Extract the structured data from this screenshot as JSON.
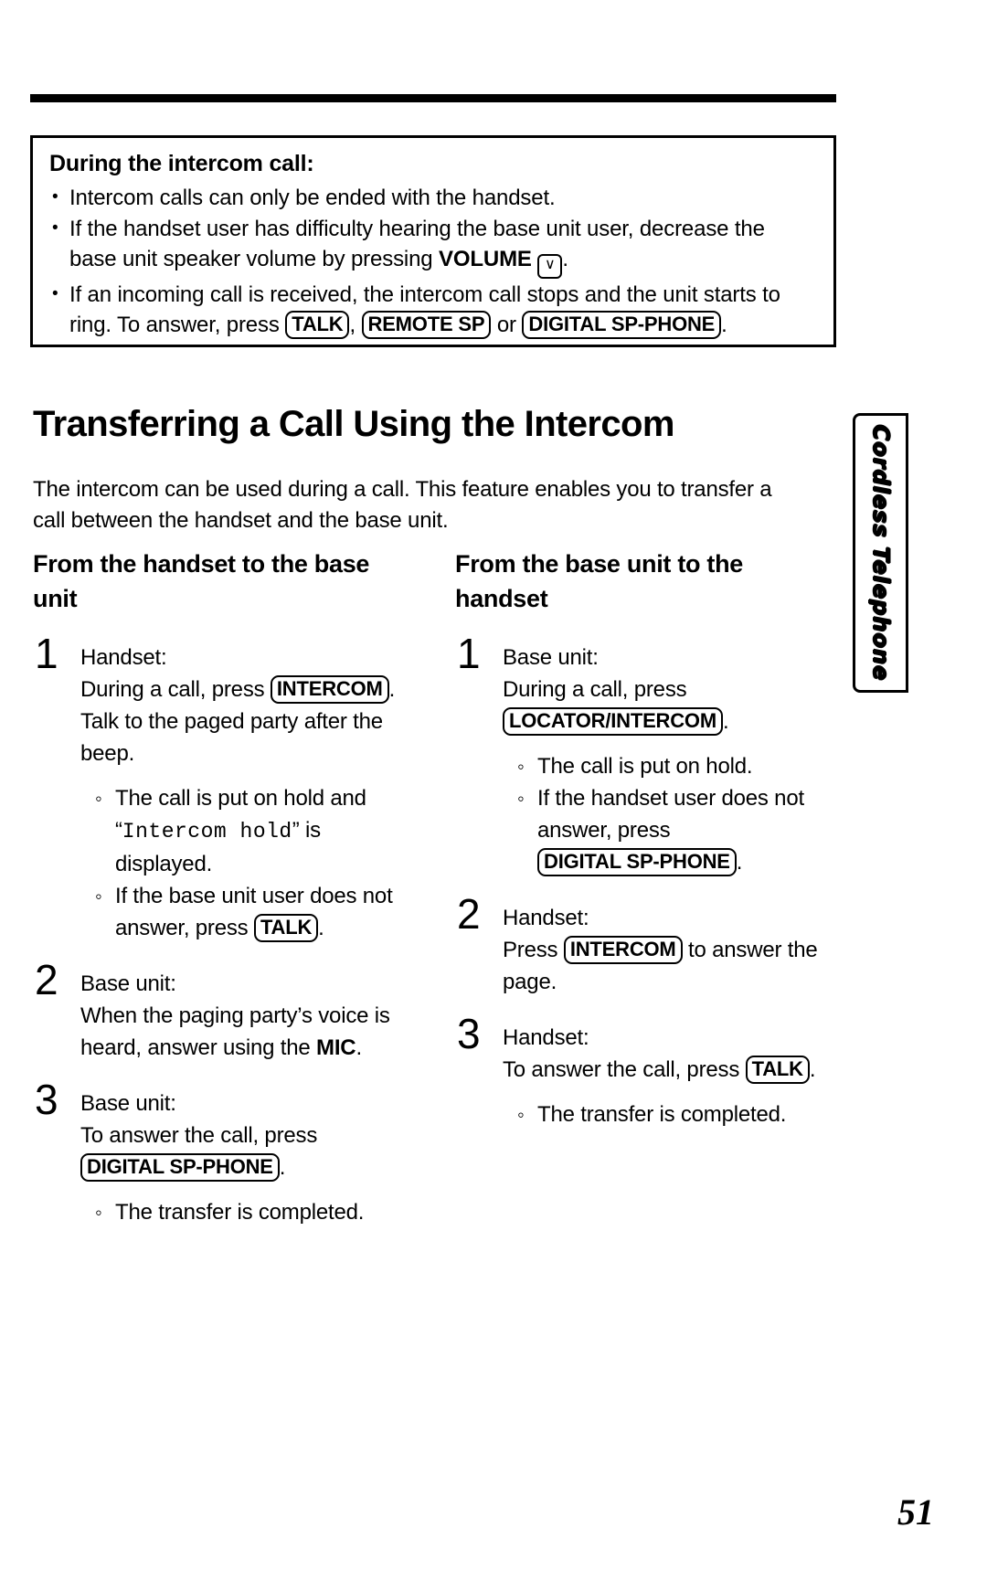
{
  "page": {
    "number": "51",
    "side_tab_label": "Cordless Telephone"
  },
  "notice": {
    "title": "During the intercom call:",
    "bullets": [
      {
        "parts": [
          {
            "type": "text",
            "value": "Intercom calls can only be ended with the handset."
          }
        ]
      },
      {
        "parts": [
          {
            "type": "text",
            "value": "If the handset user has difficulty hearing the base unit user, decrease the base unit speaker volume by pressing "
          },
          {
            "type": "bold",
            "value": "VOLUME"
          },
          {
            "type": "text",
            "value": " "
          },
          {
            "type": "key-down",
            "value": "∨"
          },
          {
            "type": "text",
            "value": "."
          }
        ]
      },
      {
        "parts": [
          {
            "type": "text",
            "value": "If an incoming call is received, the intercom call stops and the unit starts to ring. To answer, press "
          },
          {
            "type": "key",
            "value": "TALK"
          },
          {
            "type": "text",
            "value": ", "
          },
          {
            "type": "key",
            "value": "REMOTE SP"
          },
          {
            "type": "text",
            "value": " or "
          },
          {
            "type": "key",
            "value": "DIGITAL SP-PHONE"
          },
          {
            "type": "text",
            "value": "."
          }
        ]
      }
    ]
  },
  "heading": "Transferring a Call Using the Intercom",
  "intro": "The intercom can be used during a call. This feature enables you to transfer a call between the handset and the base unit.",
  "columns": [
    {
      "heading": "From the handset to the base unit",
      "steps": [
        {
          "number": "1",
          "body": [
            {
              "type": "text",
              "value": "Handset:"
            },
            {
              "type": "br"
            },
            {
              "type": "text",
              "value": "During a call, press "
            },
            {
              "type": "key",
              "value": "INTERCOM"
            },
            {
              "type": "text",
              "value": ". Talk to the paged party after the beep."
            }
          ],
          "sub_bullets": [
            {
              "parts": [
                {
                  "type": "text",
                  "value": "The call is put on hold and “"
                },
                {
                  "type": "mono",
                  "value": "Intercom hold"
                },
                {
                  "type": "text",
                  "value": "” is displayed."
                }
              ]
            },
            {
              "parts": [
                {
                  "type": "text",
                  "value": "If the base unit user does not answer, press "
                },
                {
                  "type": "key",
                  "value": "TALK"
                },
                {
                  "type": "text",
                  "value": "."
                }
              ]
            }
          ]
        },
        {
          "number": "2",
          "body": [
            {
              "type": "text",
              "value": "Base unit:"
            },
            {
              "type": "br"
            },
            {
              "type": "text",
              "value": "When the paging party’s voice is heard, answer using the "
            },
            {
              "type": "bold",
              "value": "MIC"
            },
            {
              "type": "text",
              "value": "."
            }
          ],
          "sub_bullets": []
        },
        {
          "number": "3",
          "body": [
            {
              "type": "text",
              "value": "Base unit:"
            },
            {
              "type": "br"
            },
            {
              "type": "text",
              "value": "To answer the call, press "
            },
            {
              "type": "key",
              "value": "DIGITAL SP-PHONE"
            },
            {
              "type": "text",
              "value": "."
            }
          ],
          "sub_bullets": [
            {
              "parts": [
                {
                  "type": "text",
                  "value": "The transfer is completed."
                }
              ]
            }
          ]
        }
      ]
    },
    {
      "heading": "From the base unit to the handset",
      "steps": [
        {
          "number": "1",
          "body": [
            {
              "type": "text",
              "value": "Base unit:"
            },
            {
              "type": "br"
            },
            {
              "type": "text",
              "value": "During a call, press "
            },
            {
              "type": "key",
              "value": "LOCATOR/INTERCOM"
            },
            {
              "type": "text",
              "value": "."
            }
          ],
          "sub_bullets": [
            {
              "parts": [
                {
                  "type": "text",
                  "value": "The call is put on hold."
                }
              ]
            },
            {
              "parts": [
                {
                  "type": "text",
                  "value": "If the handset user does not answer, press "
                },
                {
                  "type": "key",
                  "value": "DIGITAL SP-PHONE"
                },
                {
                  "type": "text",
                  "value": "."
                }
              ]
            }
          ]
        },
        {
          "number": "2",
          "body": [
            {
              "type": "text",
              "value": "Handset:"
            },
            {
              "type": "br"
            },
            {
              "type": "text",
              "value": "Press "
            },
            {
              "type": "key",
              "value": "INTERCOM"
            },
            {
              "type": "text",
              "value": " to answer the page."
            }
          ],
          "sub_bullets": []
        },
        {
          "number": "3",
          "body": [
            {
              "type": "text",
              "value": "Handset:"
            },
            {
              "type": "br"
            },
            {
              "type": "text",
              "value": "To answer the call, press "
            },
            {
              "type": "key",
              "value": "TALK"
            },
            {
              "type": "text",
              "value": "."
            }
          ],
          "sub_bullets": [
            {
              "parts": [
                {
                  "type": "text",
                  "value": "The transfer is completed."
                }
              ]
            }
          ]
        }
      ]
    }
  ]
}
